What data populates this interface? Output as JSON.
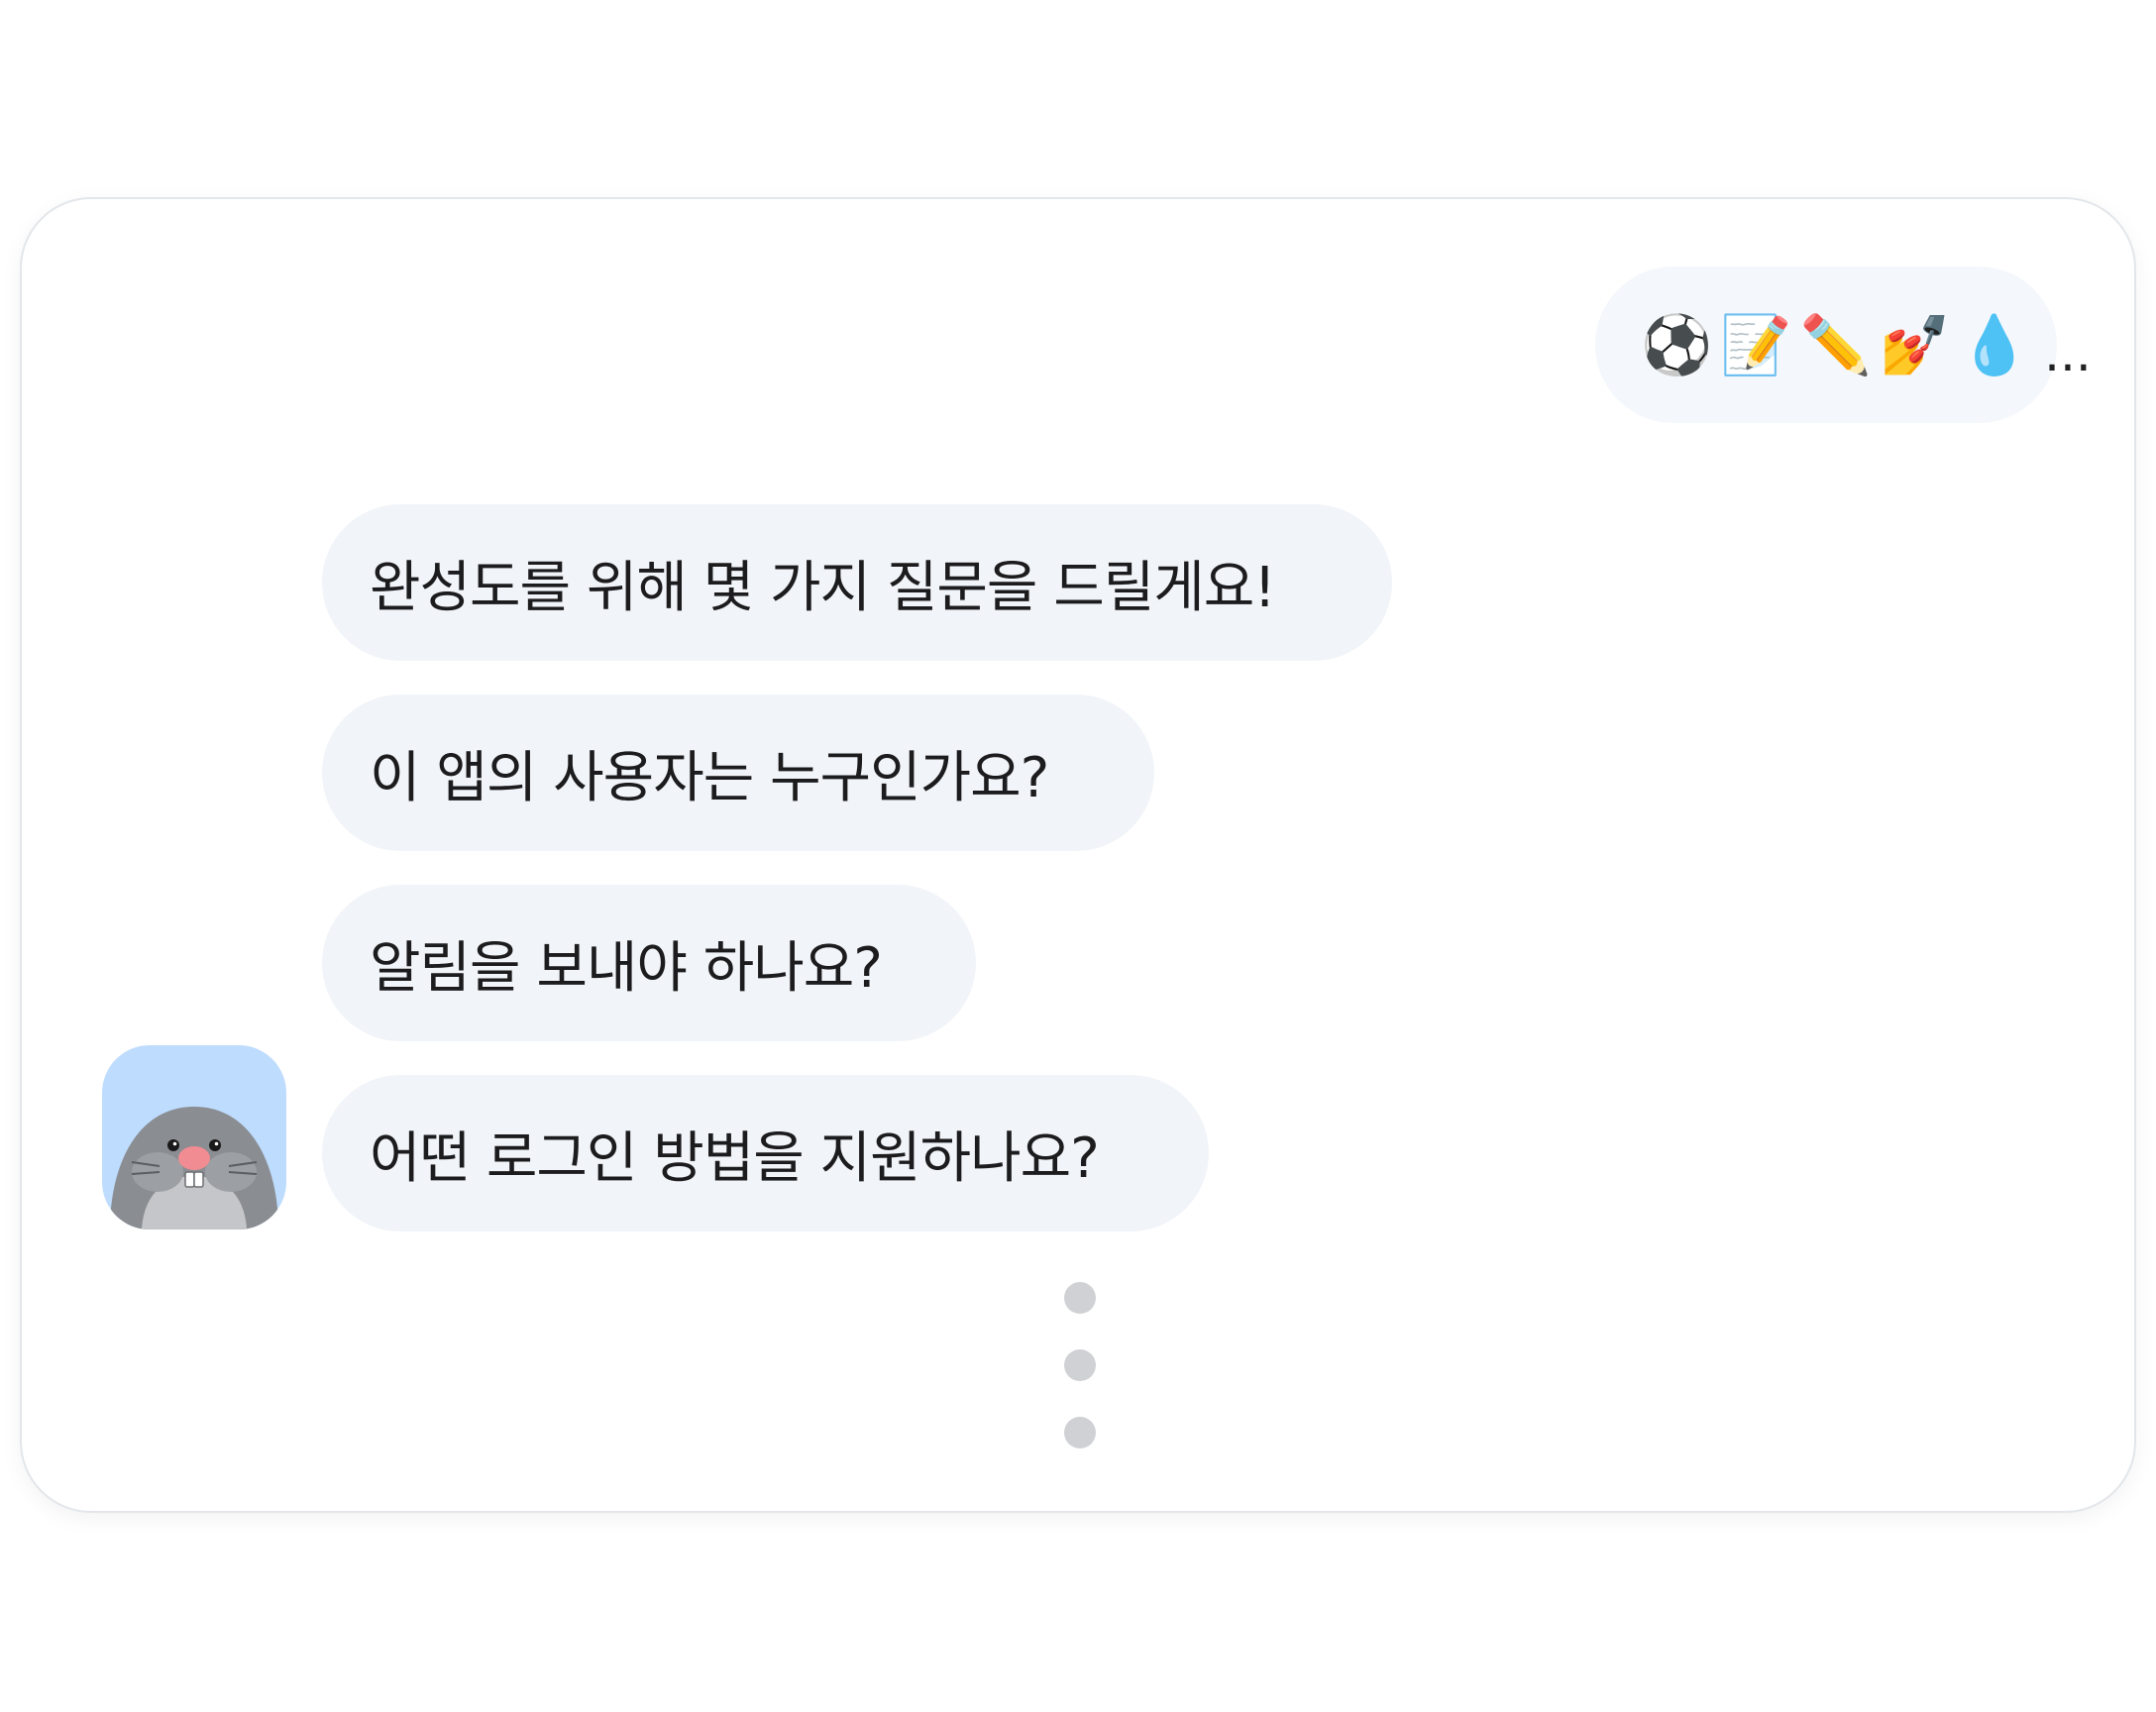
{
  "user_message": {
    "emojis": [
      "⚽",
      "📝",
      "✏️",
      "💅",
      "💧"
    ],
    "ellipsis": "..."
  },
  "bot_messages": [
    "완성도를 위해 몇 가지 질문을 드릴게요!",
    "이 앱의 사용자는 누구인가요?",
    "알림을 보내야 하나요?",
    "어떤 로그인 방법을 지원하나요?"
  ],
  "avatar_icon": "mole-avatar-icon",
  "typing_indicator_icon": "typing-dots-icon",
  "colors": {
    "user_bubble": "#f4f7fb",
    "bot_bubble": "#f1f4f8",
    "avatar_bg": "#bedcfd",
    "typing_dot": "#cfd1d4"
  }
}
